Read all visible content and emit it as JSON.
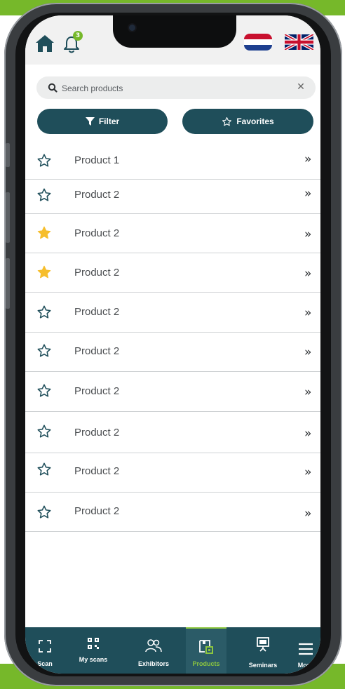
{
  "header": {
    "notification_count": "3",
    "home_icon": "home-icon",
    "bell_icon": "bell-icon",
    "languages": [
      "nl-flag-icon",
      "uk-flag-icon"
    ]
  },
  "search": {
    "placeholder": "Search products",
    "value": ""
  },
  "actions": {
    "filter_label": "Filter",
    "favorites_label": "Favorites"
  },
  "products": [
    {
      "name": "Product 1",
      "favorite": false
    },
    {
      "name": "Product 2",
      "favorite": false
    },
    {
      "name": "Product 2",
      "favorite": true
    },
    {
      "name": "Product 2",
      "favorite": true
    },
    {
      "name": "Product 2",
      "favorite": false
    },
    {
      "name": "Product 2",
      "favorite": false
    },
    {
      "name": "Product 2",
      "favorite": false
    },
    {
      "name": "Product 2",
      "favorite": false
    },
    {
      "name": "Product 2",
      "favorite": false
    },
    {
      "name": "Product 2",
      "favorite": false
    }
  ],
  "tabbar": {
    "tabs": [
      {
        "label": "Scan",
        "icon": "scan-icon"
      },
      {
        "label": "My scans",
        "icon": "qr-code-icon"
      },
      {
        "label": "Exhibitors",
        "icon": "people-icon"
      },
      {
        "label": "Products",
        "icon": "product-box-icon",
        "active": true
      },
      {
        "label": "Seminars",
        "icon": "presentation-icon"
      },
      {
        "label": "More",
        "icon": "menu-icon"
      }
    ]
  },
  "colors": {
    "brand_dark": "#1f4e5a",
    "accent_green": "#76b82a",
    "favorite_star": "#f6be2c"
  }
}
